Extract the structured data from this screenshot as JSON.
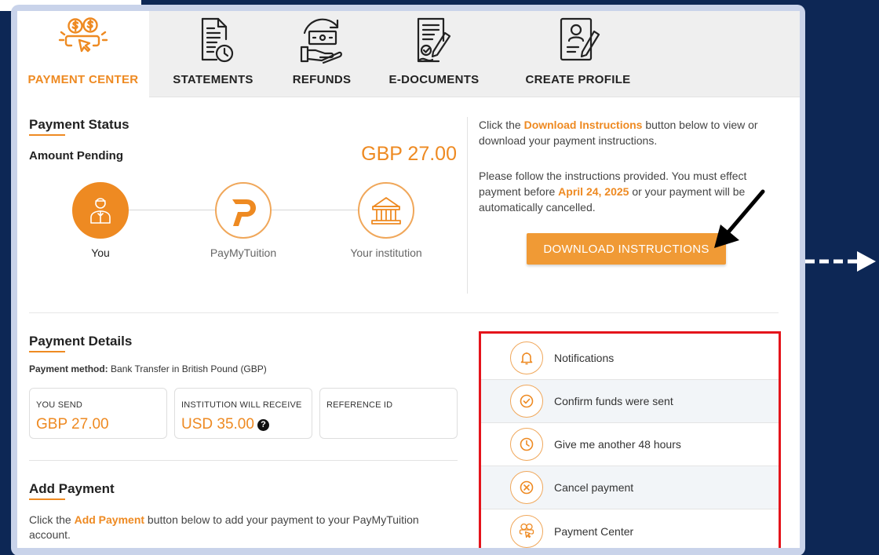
{
  "tabs": [
    {
      "label": "PAYMENT CENTER",
      "icon": "payment-center-icon",
      "active": true
    },
    {
      "label": "STATEMENTS",
      "icon": "statements-icon"
    },
    {
      "label": "REFUNDS",
      "icon": "refunds-icon"
    },
    {
      "label": "E-DOCUMENTS",
      "icon": "e-documents-icon"
    },
    {
      "label": "CREATE PROFILE",
      "icon": "create-profile-icon"
    }
  ],
  "status": {
    "title": "Payment Status",
    "amount_label": "Amount Pending",
    "amount_value": "GBP 27.00",
    "flow": [
      {
        "label": "You",
        "icon": "user-icon"
      },
      {
        "label": "PayMyTuition",
        "icon": "paymytuition-logo-icon"
      },
      {
        "label": "Your institution",
        "icon": "institution-icon"
      }
    ]
  },
  "instructions": {
    "p1_before": "Click the ",
    "p1_highlight": "Download Instructions",
    "p1_after": " button below to view or download your payment instructions.",
    "p2_before": "Please follow the instructions provided. You must effect payment before ",
    "p2_highlight": "April 24, 2025",
    "p2_after": " or your payment will be automatically cancelled.",
    "button_label": "DOWNLOAD INSTRUCTIONS"
  },
  "details": {
    "title": "Payment Details",
    "method_label": "Payment method:",
    "method_value": " Bank Transfer in British Pound (GBP)",
    "boxes": [
      {
        "label": "YOU SEND",
        "value": "GBP 27.00"
      },
      {
        "label": "INSTITUTION WILL RECEIVE",
        "value": "USD 35.00"
      },
      {
        "label": "REFERENCE ID",
        "value": ""
      }
    ]
  },
  "add_payment": {
    "title": "Add Payment",
    "text_before": "Click the ",
    "text_highlight": "Add Payment",
    "text_after": " button below to add your payment to your PayMyTuition account."
  },
  "actions": [
    {
      "label": "Notifications",
      "icon": "bell-icon"
    },
    {
      "label": "Confirm funds were sent",
      "icon": "check-circle-icon"
    },
    {
      "label": "Give me another 48 hours",
      "icon": "clock-icon"
    },
    {
      "label": "Cancel payment",
      "icon": "cancel-circle-icon"
    },
    {
      "label": "Payment Center",
      "icon": "payment-center-icon"
    }
  ],
  "colors": {
    "accent": "#ee8a22",
    "background": "#0d2755",
    "highlight_border": "#e4141b"
  }
}
